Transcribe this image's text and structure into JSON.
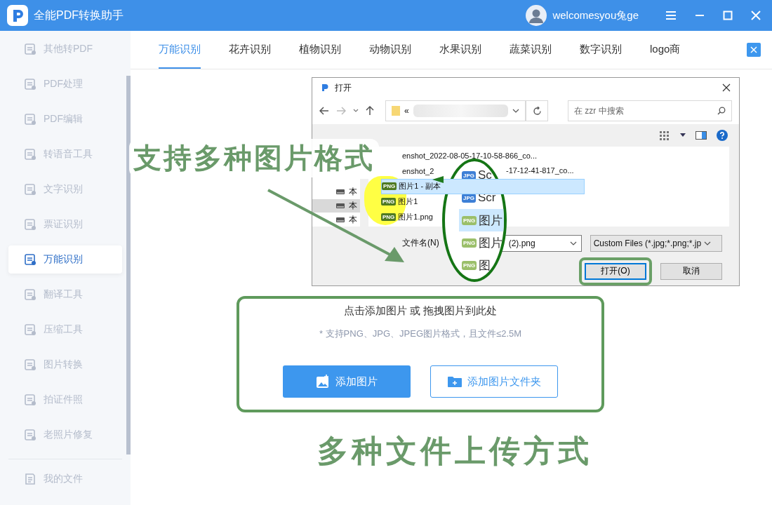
{
  "app": {
    "title": "全能PDF转换助手",
    "user": "welcomesyou兔ge"
  },
  "sidebar": {
    "items": [
      {
        "label": "其他转PDF",
        "selected": false
      },
      {
        "label": "PDF处理",
        "selected": false
      },
      {
        "label": "PDF编辑",
        "selected": false
      },
      {
        "label": "转语音工具",
        "selected": false
      },
      {
        "label": "文字识别",
        "selected": false
      },
      {
        "label": "票证识别",
        "selected": false
      },
      {
        "label": "万能识别",
        "selected": true
      },
      {
        "label": "翻译工具",
        "selected": false
      },
      {
        "label": "压缩工具",
        "selected": false
      },
      {
        "label": "图片转换",
        "selected": false
      },
      {
        "label": "拍证件照",
        "selected": false
      },
      {
        "label": "老照片修复",
        "selected": false
      }
    ],
    "footer_item": "我的文件"
  },
  "tabs": [
    {
      "label": "万能识别",
      "selected": true
    },
    {
      "label": "花卉识别",
      "selected": false
    },
    {
      "label": "植物识别",
      "selected": false
    },
    {
      "label": "动物识别",
      "selected": false
    },
    {
      "label": "水果识别",
      "selected": false
    },
    {
      "label": "蔬菜识别",
      "selected": false
    },
    {
      "label": "数字识别",
      "selected": false
    },
    {
      "label": "logo商",
      "selected": false
    }
  ],
  "upload": {
    "title": "点击添加图片 或 拖拽图片到此处",
    "hint": "* 支持PNG、JPG、JPEG图片格式，且文件≤2.5M",
    "buttons": [
      {
        "label": "添加图片",
        "kind": "primary"
      },
      {
        "label": "添加图片文件夹",
        "kind": "outline"
      }
    ]
  },
  "dialog": {
    "title": "打开",
    "path_prefix": "«",
    "search_placeholder": "在 zzr 中搜索",
    "nav_items": [
      {
        "label": "本",
        "selected": false
      },
      {
        "label": "本",
        "selected": true
      },
      {
        "label": "本",
        "selected": false
      }
    ],
    "files": [
      {
        "name": "enshot_2022-08-05-17-10-58-866_co...",
        "selected": false
      },
      {
        "name": "enshot_2",
        "tail": "-17-12-41-817_co...",
        "selected": false
      },
      {
        "name": "图片1 - 副本",
        "type": "PNG",
        "selected": true
      },
      {
        "name": "图片1",
        "type": "PNG",
        "selected": false
      },
      {
        "name": "图片1.png",
        "type": "PNG",
        "selected": false
      }
    ],
    "filename_label": "文件名(N)",
    "filename_value": "(2).png",
    "filter": "Custom Files (*.jpg;*.png;*.jp",
    "buttons": [
      {
        "label": "打开(O)",
        "kind": "default"
      },
      {
        "label": "取消",
        "kind": "normal"
      }
    ]
  },
  "magnifier": {
    "items": [
      {
        "type": "JPG",
        "text": "Sc",
        "selected": false
      },
      {
        "type": "JPG",
        "text": "Scr",
        "selected": false
      },
      {
        "type": "PNG",
        "text": "图片",
        "selected": true
      },
      {
        "type": "PNG",
        "text": "图片",
        "selected": false
      },
      {
        "type": "PNG",
        "text": "图",
        "selected": false
      }
    ]
  },
  "annotations": [
    "支持多种图片格式",
    "多种文件上传方式"
  ]
}
